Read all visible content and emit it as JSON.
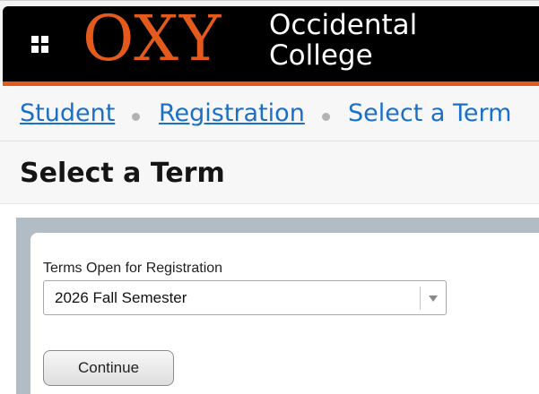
{
  "brand": {
    "logo_text": "OXY",
    "college_line1": "Occidental",
    "college_line2": "College",
    "accent_color": "#e35a1c",
    "header_color": "#000000"
  },
  "menu": {
    "icon": "grid-icon"
  },
  "breadcrumb": {
    "items": [
      {
        "label": "Student",
        "link": true
      },
      {
        "label": "Registration",
        "link": true
      },
      {
        "label": "Select a Term",
        "link": false
      }
    ],
    "link_color": "#1a70c7"
  },
  "page": {
    "title": "Select a Term"
  },
  "form": {
    "terms_label": "Terms Open for Registration",
    "terms_select": {
      "value": "2026 Fall Semester"
    },
    "continue_label": "Continue"
  }
}
